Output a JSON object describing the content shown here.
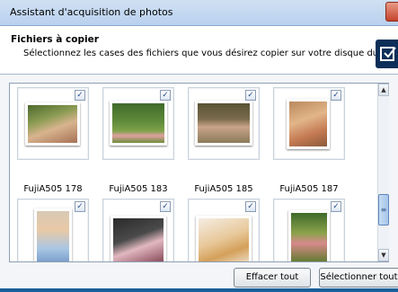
{
  "window": {
    "title": "Assistant d'acquisition de photos"
  },
  "header": {
    "heading": "Fichiers à copier",
    "subtitle": "Sélectionnez les cases des fichiers que vous désirez copier sur votre disque dur."
  },
  "photos": [
    {
      "caption": "FujiA505 178",
      "checked": "✓"
    },
    {
      "caption": "FujiA505 183",
      "checked": "✓"
    },
    {
      "caption": "FujiA505 185",
      "checked": "✓"
    },
    {
      "caption": "FujiA505 187",
      "checked": "✓"
    },
    {
      "caption": "",
      "checked": "✓"
    },
    {
      "caption": "",
      "checked": "✓"
    },
    {
      "caption": "",
      "checked": "✓"
    },
    {
      "caption": "",
      "checked": "✓"
    }
  ],
  "buttons": {
    "clear_all": "Effacer tout",
    "select_all": "Sélectionner tout"
  },
  "scrollbar": {
    "up": "▲",
    "down": "▼",
    "grip": "≡"
  },
  "colors": {
    "title_bar": "#b9d1ee",
    "accent": "#1a5f9a"
  }
}
